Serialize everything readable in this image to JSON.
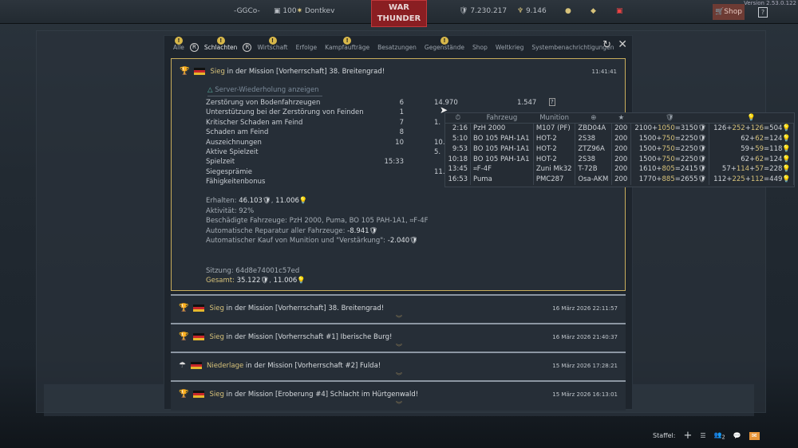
{
  "topbar": {
    "squad": "-GGCo-",
    "level": "100",
    "player": "Dontkev",
    "logo": "WAR THUNDER",
    "silver_lions": "7.230.217",
    "gold_eagles": "9.146",
    "shop": "Shop",
    "help": "?",
    "version": "Version 2.53.0.122"
  },
  "tabs": [
    {
      "label": "Alle",
      "badge": "!"
    },
    {
      "label": "Schlachten",
      "badge": "!",
      "active": true
    },
    {
      "label": "Wirtschaft",
      "badge": "!"
    },
    {
      "label": "Erfolge"
    },
    {
      "label": "Kampfaufträge",
      "badge": "!"
    },
    {
      "label": "Besatzungen"
    },
    {
      "label": "Gegenstände",
      "badge": "!"
    },
    {
      "label": "Shop"
    },
    {
      "label": "Weltkrieg"
    },
    {
      "label": "Systembenachrichtigungen"
    }
  ],
  "nav": {
    "prev": "R",
    "next": "R"
  },
  "expanded": {
    "result": "Sieg",
    "title": " in der Mission [Vorherrschaft] 38. Breitengrad!",
    "time": "11:41:41",
    "replay": "Server-Wiederholung anzeigen",
    "stats": [
      {
        "label": "Zerstörung von Bodenfahrzeugen",
        "count": "6",
        "sl": "14.970",
        "rp": "1.547",
        "help": "?"
      },
      {
        "label": "Unterstützung bei der Zerstörung von Feinden",
        "count": "1",
        "sl": "",
        "rp": ""
      },
      {
        "label": "Kritischer Schaden am Feind",
        "count": "7",
        "sl": "1.",
        "rp": ""
      },
      {
        "label": "Schaden am Feind",
        "count": "8",
        "sl": "",
        "rp": ""
      },
      {
        "label": "Auszeichnungen",
        "count": "10",
        "sl": "10.",
        "rp": ""
      },
      {
        "label": "Aktive Spielzeit",
        "count": "",
        "sl": "5.",
        "rp": ""
      },
      {
        "label": "Spielzeit",
        "count": "15:33",
        "sl": "",
        "rp": ""
      },
      {
        "label": "Siegesprämie",
        "count": "",
        "sl": "11.",
        "rp": ""
      },
      {
        "label": "Fähigkeitenbonus",
        "count": "",
        "sl": "",
        "rp": ""
      }
    ],
    "received_label": "Erhalten:",
    "received_sl": "46.103",
    "received_rp": "11.006",
    "activity_label": "Aktivität:",
    "activity": "92%",
    "damaged_label": "Beschädigte Fahrzeuge:",
    "damaged": "PzH 2000, Puma, BO 105 PAH-1A1, ⌗F-4F",
    "repair_label": "Automatische Reparatur aller Fahrzeuge:",
    "repair": "-8.941",
    "ammo_label": "Automatischer Kauf von Munition und \"Verstärkung\":",
    "ammo": "-2.040",
    "session_label": "Sitzung:",
    "session": "64d8e74001c57ed",
    "total_label": "Gesamt:",
    "total_sl": "35.122",
    "total_rp": "11.006"
  },
  "tooltip": {
    "headers": {
      "time": "⏱",
      "vehicle": "Fahrzeug",
      "ammo": "Munition",
      "target": "⊕",
      "rank": "★",
      "sl": "🛡",
      "rp": "💡"
    },
    "rows": [
      {
        "time": "2:16",
        "vehicle": "PzH 2000",
        "ammo": "M107 (PF)",
        "target": "ZBD04A",
        "rank": "200",
        "sl_base": "2100",
        "sl_bonus": "1050",
        "sl_total": "3150",
        "rp_base": "126",
        "rp_bonus": "252",
        "rp_extra": "126",
        "rp_total": "504"
      },
      {
        "time": "5:10",
        "vehicle": "BO 105 PAH-1A1",
        "ammo": "HOT-2",
        "target": "2S38",
        "rank": "200",
        "sl_base": "1500",
        "sl_bonus": "750",
        "sl_total": "2250",
        "rp_base": "62",
        "rp_bonus": "62",
        "rp_extra": "",
        "rp_total": "124"
      },
      {
        "time": "9:53",
        "vehicle": "BO 105 PAH-1A1",
        "ammo": "HOT-2",
        "target": "ZTZ96A",
        "rank": "200",
        "sl_base": "1500",
        "sl_bonus": "750",
        "sl_total": "2250",
        "rp_base": "59",
        "rp_bonus": "59",
        "rp_extra": "",
        "rp_total": "118"
      },
      {
        "time": "10:18",
        "vehicle": "BO 105 PAH-1A1",
        "ammo": "HOT-2",
        "target": "2S38",
        "rank": "200",
        "sl_base": "1500",
        "sl_bonus": "750",
        "sl_total": "2250",
        "rp_base": "62",
        "rp_bonus": "62",
        "rp_extra": "",
        "rp_total": "124"
      },
      {
        "time": "13:45",
        "vehicle": "⌗F-4F",
        "ammo": "Zuni Mk32",
        "target": "T-72B",
        "rank": "200",
        "sl_base": "1610",
        "sl_bonus": "805",
        "sl_total": "2415",
        "rp_base": "57",
        "rp_bonus": "114",
        "rp_extra": "57",
        "rp_total": "228"
      },
      {
        "time": "16:53",
        "vehicle": "Puma",
        "ammo": "PMC287",
        "target": "Osa-AKM",
        "rank": "200",
        "sl_base": "1770",
        "sl_bonus": "885",
        "sl_total": "2655",
        "rp_base": "112",
        "rp_bonus": "225",
        "rp_extra": "112",
        "rp_total": "449"
      }
    ]
  },
  "battles": [
    {
      "result": "Sieg",
      "title": " in der Mission [Vorherrschaft] 38. Breitengrad!",
      "time": "16 März 2026 22:11:57",
      "icon": "trophy-icon"
    },
    {
      "result": "Sieg",
      "title": " in der Mission [Vorherrschaft #1] Iberische Burg!",
      "time": "16 März 2026 21:40:37",
      "icon": "trophy-icon"
    },
    {
      "result": "Niederlage",
      "title": " in der Mission [Vorherrschaft #2] Fulda!",
      "time": "15 März 2026 17:28:21",
      "icon": "parachute-icon"
    },
    {
      "result": "Sieg",
      "title": " in der Mission [Eroberung #4] Schlacht im Hürtgenwald!",
      "time": "15 März 2026 16:13:01",
      "icon": "trophy-icon"
    }
  ],
  "bottombar": {
    "squad_label": "Staffel:",
    "friends_count": "2"
  },
  "colors": {
    "accent_gold": "#d7c27a",
    "border_gold": "#c8ad5c",
    "logo_red": "#8a1e22",
    "mail": "#e8963a"
  }
}
